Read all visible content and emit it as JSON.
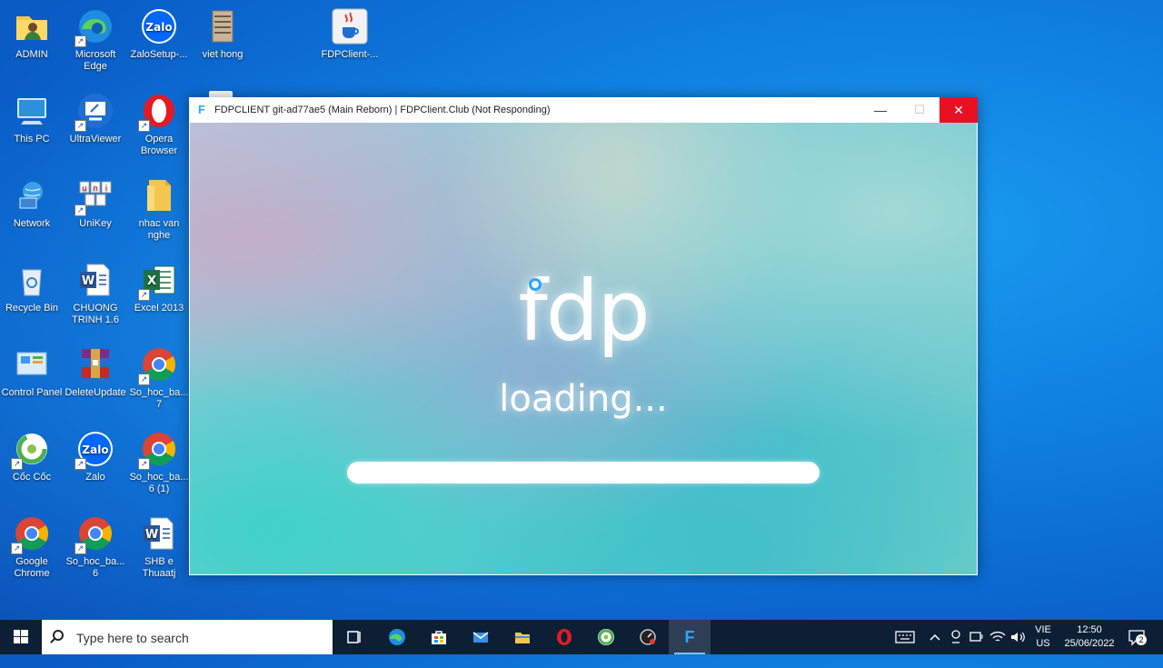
{
  "desktop": {
    "icons": [
      {
        "label": "ADMIN"
      },
      {
        "label": "Microsoft Edge"
      },
      {
        "label": "ZaloSetup-..."
      },
      {
        "label": "viet hong"
      },
      {
        "label": "FDPClient-..."
      },
      {
        "label": "This PC"
      },
      {
        "label": "UltraViewer"
      },
      {
        "label": "Opera Browser"
      },
      {
        "label": "Network"
      },
      {
        "label": "UniKey"
      },
      {
        "label": "nhac van nghe"
      },
      {
        "label": "Recycle Bin"
      },
      {
        "label": "CHUONG TRINH 1.6"
      },
      {
        "label": "Excel 2013"
      },
      {
        "label": "Control Panel"
      },
      {
        "label": "DeleteUpdate"
      },
      {
        "label": "So_hoc_ba... 7"
      },
      {
        "label": "Cốc Cốc"
      },
      {
        "label": "Zalo"
      },
      {
        "label": "So_hoc_ba... 6 (1)"
      },
      {
        "label": "Google Chrome"
      },
      {
        "label": "So_hoc_ba... 6"
      },
      {
        "label": "SHB e Thuaatj"
      }
    ],
    "icon_glyphs": {
      "zalo": "Zalo",
      "word": "W",
      "excel": "X",
      "java": "☕",
      "unikey": "u"
    }
  },
  "window": {
    "title": "FDPCLIENT git-ad77ae5 (Main Reborn) | FDPClient.Club (Not Responding)",
    "app_icon": "F",
    "minimize": "—",
    "maximize": "☐",
    "close": "✕",
    "logo": "fdp",
    "loading_text": "loading...",
    "progress_percent": 100
  },
  "taskbar": {
    "search_placeholder": "Type here to search",
    "language_line1": "VIE",
    "language_line2": "US",
    "time": "12:50",
    "date": "25/06/2022",
    "notification_count": "2",
    "fdp_app_glyph": "F"
  },
  "colors": {
    "close_button": "#e81123",
    "taskbar": "#0c1f35",
    "accent": "#2fa4ff"
  }
}
